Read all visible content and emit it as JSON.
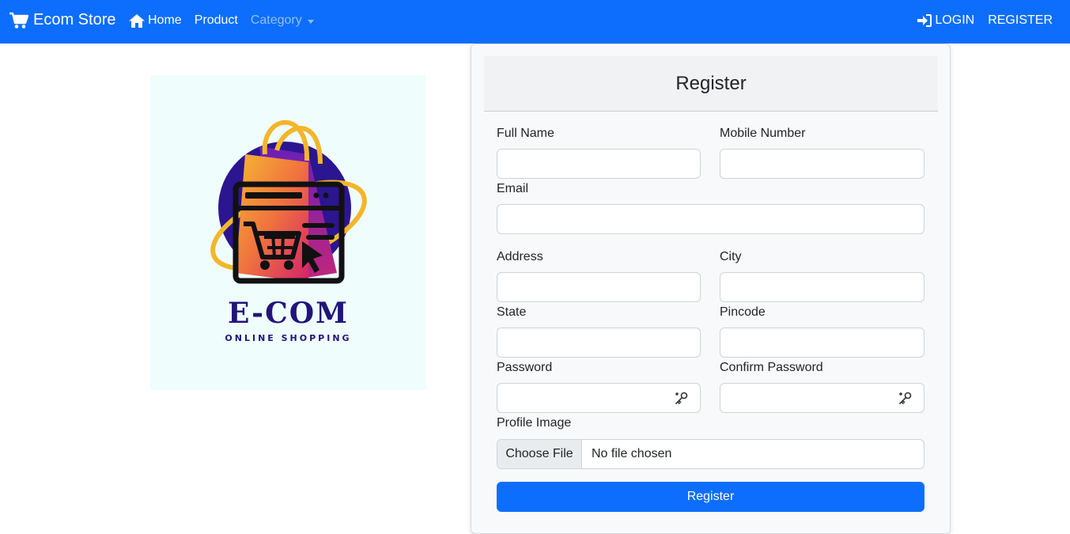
{
  "nav": {
    "brand": "Ecom Store",
    "home": "Home",
    "product": "Product",
    "category": "Category",
    "login": "LOGIN",
    "register": "REGISTER"
  },
  "logo": {
    "title": "E-COM",
    "subtitle": "ONLINE SHOPPING"
  },
  "form": {
    "title": "Register",
    "full_name_label": "Full Name",
    "mobile_label": "Mobile Number",
    "email_label": "Email",
    "address_label": "Address",
    "city_label": "City",
    "state_label": "State",
    "pincode_label": "Pincode",
    "password_label": "Password",
    "confirm_password_label": "Confirm Password",
    "profile_image_label": "Profile Image",
    "choose_file": "Choose File",
    "no_file": "No file chosen",
    "submit": "Register"
  },
  "colors": {
    "primary": "#0d6efd",
    "logo_navy": "#21157a",
    "logo_orange": "#f5a623"
  }
}
